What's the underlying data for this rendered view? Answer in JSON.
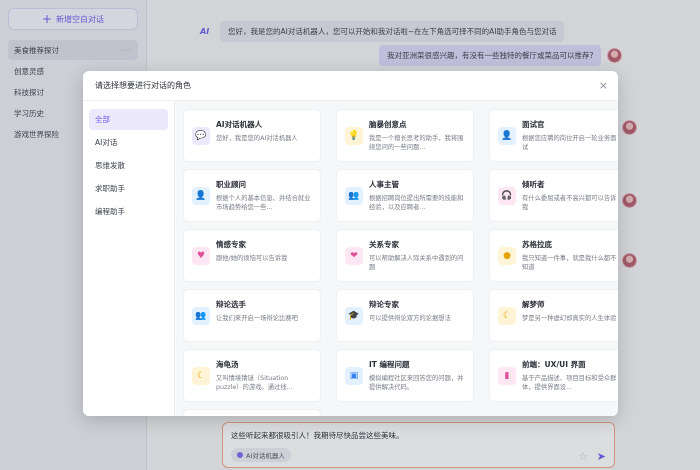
{
  "sidebar": {
    "new_chat": "新增空白对话",
    "conversations": [
      "美食推荐探讨",
      "创意灵感",
      "科技探讨",
      "学习历史",
      "游戏世界探险"
    ]
  },
  "chat": {
    "bot_message": "您好，我是您的AI对话机器人，您可以开始和我对话啦~在左下角选可择不同的AI助手角色与您对话",
    "user_message": "我对亚洲菜很感兴趣，有没有一些独特的餐厅或菜品可以推荐?",
    "input_text": "这些听起来都很吸引人！我期待尽快品尝这些美味。",
    "chip_label": "AI对话机器人"
  },
  "modal": {
    "title": "请选择想要进行对话的角色",
    "close": "×",
    "categories": [
      "全部",
      "AI对话",
      "思维发散",
      "求职助手",
      "编程助手"
    ],
    "cards": [
      {
        "title": "AI对话机器人",
        "desc": "您好，我是您的AI对话机器人",
        "icon": "💬",
        "bg": "#ece9fd",
        "fg": "#6b5cf0"
      },
      {
        "title": "脑暴创意点",
        "desc": "我是一个擅长思考的助手，我将围绕您问的一些问题...",
        "icon": "💡",
        "bg": "#fff4d6",
        "fg": "#e6a300"
      },
      {
        "title": "面试官",
        "desc": "根据您应聘的岗位开启一轮业务面试",
        "icon": "👤",
        "bg": "#e3f0ff",
        "fg": "#3b82f6"
      },
      {
        "title": "职业顾问",
        "desc": "根据个人的基本信息、并结合就业市场趋势给您一些...",
        "icon": "👤",
        "bg": "#e3f0ff",
        "fg": "#3b82f6"
      },
      {
        "title": "人事主管",
        "desc": "根据招聘岗位提出所需要的技能和经验，以及应聘者...",
        "icon": "👥",
        "bg": "#e3f0ff",
        "fg": "#3b82f6"
      },
      {
        "title": "倾听者",
        "desc": "有什么委屈或者不高兴都可以告诉我",
        "icon": "🎧",
        "bg": "#ffe6f3",
        "fg": "#e0509a"
      },
      {
        "title": "情感专家",
        "desc": "跟他/她的烦恼可以告诉我",
        "icon": "♥",
        "bg": "#ffe6f3",
        "fg": "#e0509a"
      },
      {
        "title": "关系专家",
        "desc": "可以帮助解决人际关系中遇到的问题",
        "icon": "❤",
        "bg": "#ffe6f3",
        "fg": "#e0509a"
      },
      {
        "title": "苏格拉底",
        "desc": "我只知道一件事，就是我什么都不知道",
        "icon": "●",
        "bg": "#fff4d6",
        "fg": "#e6a300"
      },
      {
        "title": "辩论选手",
        "desc": "让我们来开启一场辩论比赛吧",
        "icon": "👥",
        "bg": "#e3f0ff",
        "fg": "#3b82f6"
      },
      {
        "title": "辩论专家",
        "desc": "可以提供辩论双方的论据想法",
        "icon": "🎓",
        "bg": "#e3f0ff",
        "fg": "#3b82f6"
      },
      {
        "title": "解梦师",
        "desc": "梦是另一种虚幻却真实的人生体验",
        "icon": "☾",
        "bg": "#fff4d6",
        "fg": "#e6a300"
      },
      {
        "title": "海龟汤",
        "desc": "又叫情境猜谜（Situation puzzle）的游戏。通过线...",
        "icon": "☾",
        "bg": "#fff4d6",
        "fg": "#e6a300"
      },
      {
        "title": "IT 编程问题",
        "desc": "模拟编程社区来回答您的问题，并提供解决代码。",
        "icon": "▣",
        "bg": "#e3f0ff",
        "fg": "#3b82f6"
      },
      {
        "title": "前端：UX/UI 界面",
        "desc": "基于产品描述、项目目标和受众群体，提供界面设...",
        "icon": "▮",
        "bg": "#ffe6f3",
        "fg": "#e0509a"
      }
    ]
  }
}
